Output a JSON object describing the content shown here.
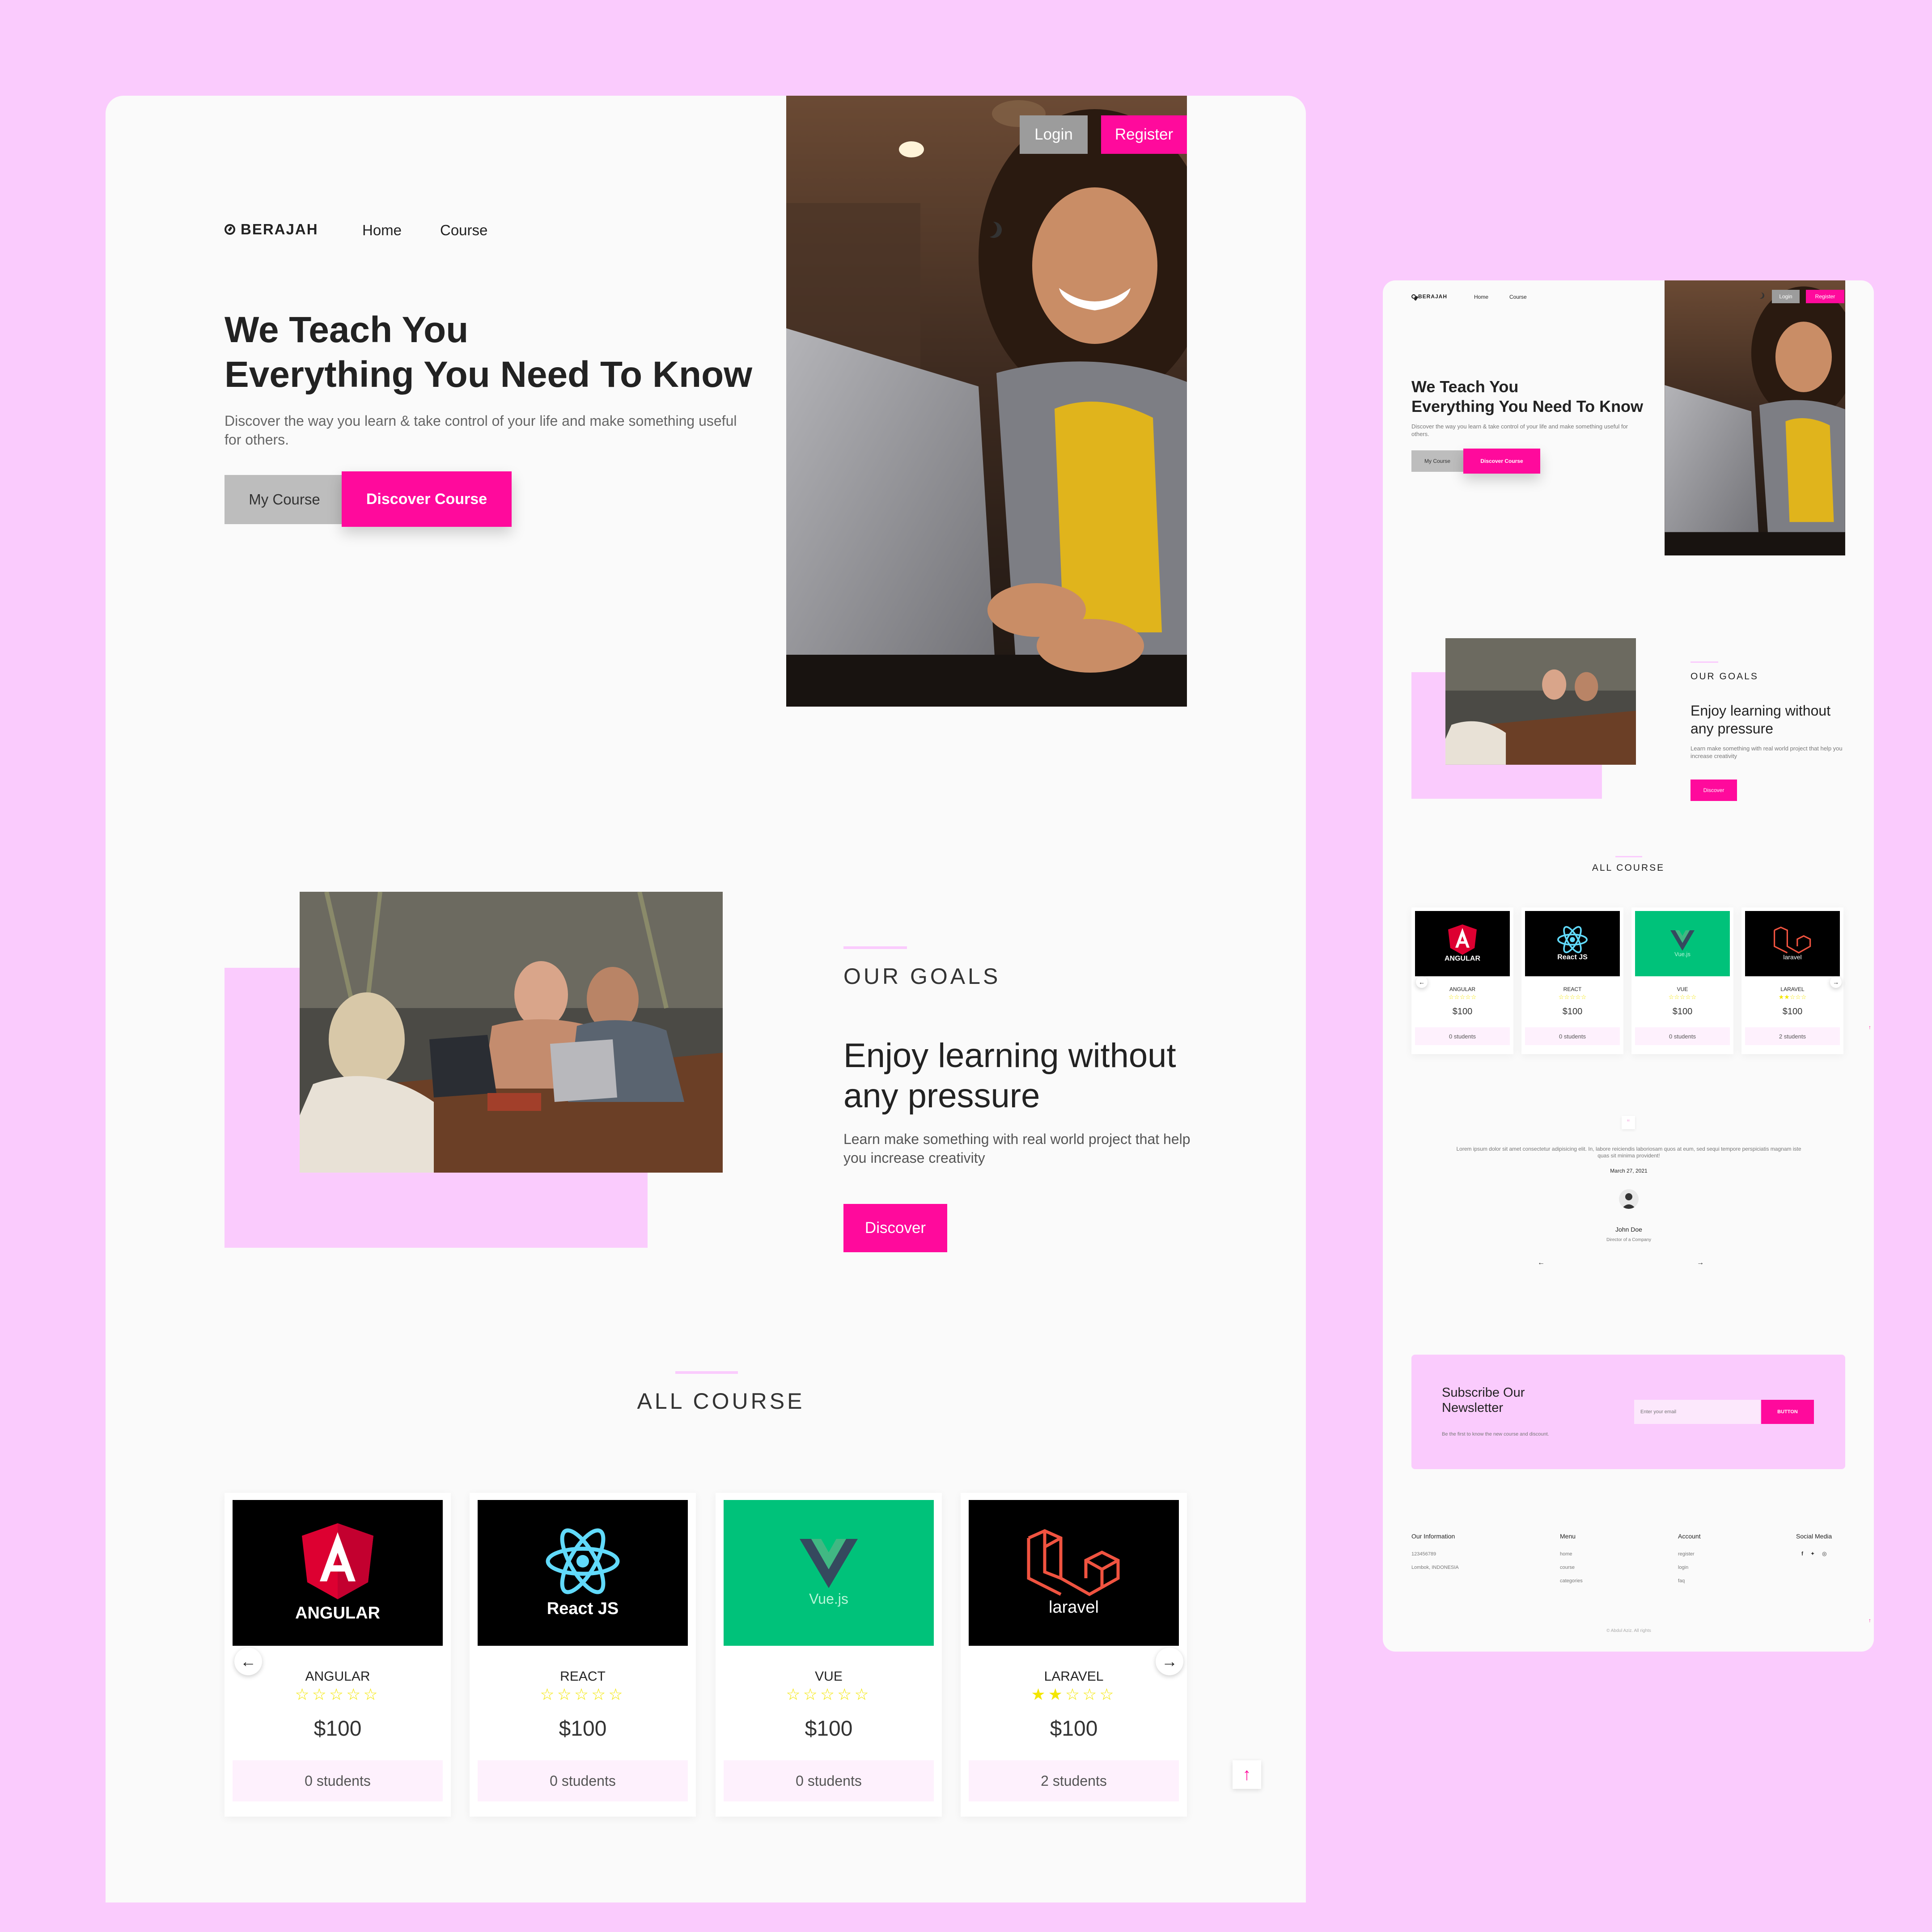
{
  "brand": "BERAJAH",
  "nav": {
    "home": "Home",
    "course": "Course"
  },
  "auth": {
    "login": "Login",
    "register": "Register"
  },
  "hero": {
    "title_line1": "We Teach You",
    "title_line2": "Everything You Need To Know",
    "description": "Discover the way you learn & take control of your life and make something useful for others.",
    "btn_my_course": "My Course",
    "btn_discover_course": "Discover Course"
  },
  "goals": {
    "label": "OUR GOALS",
    "title": "Enjoy learning without any pressure",
    "description": "Learn make something with real world project that help you increase creativity",
    "button": "Discover"
  },
  "all_course": {
    "title": "ALL COURSE",
    "courses": [
      {
        "name": "ANGULAR",
        "logo_text": "ANGULAR",
        "rating": 0,
        "price": "$100",
        "students": "0 students",
        "thumb_color": "#000000"
      },
      {
        "name": "REACT",
        "logo_text": "React JS",
        "rating": 0,
        "price": "$100",
        "students": "0 students",
        "thumb_color": "#000000"
      },
      {
        "name": "VUE",
        "logo_text": "Vue.js",
        "rating": 0,
        "price": "$100",
        "students": "0 students",
        "thumb_color": "#00c27a"
      },
      {
        "name": "LARAVEL",
        "logo_text": "laravel",
        "rating": 2,
        "price": "$100",
        "students": "2 students",
        "thumb_color": "#000000"
      }
    ]
  },
  "testimonial": {
    "quote": "Lorem ipsum dolor sit amet consectetur adipisicing elit. In, labore reiciendis laboriosam quos at eum, sed sequi tempore perspiciatis magnam iste quas sit minima provident!",
    "date": "March 27, 2021",
    "name": "John Doe",
    "role": "Director of a Company"
  },
  "newsletter": {
    "title_line1": "Subscribe Our",
    "title_line2": "Newsletter",
    "description": "Be the first to know the new course and discount.",
    "placeholder": "Enter your email",
    "button": "BUTTON"
  },
  "footer": {
    "info_title": "Our Information",
    "info_phone": "123456789",
    "info_address": "Lombok, INDONESIA",
    "menu_title": "Menu",
    "menu_items": [
      "home",
      "course",
      "categories"
    ],
    "account_title": "Account",
    "account_items": [
      "register",
      "login",
      "faq"
    ],
    "social_title": "Social Media",
    "copyright": "© Abdul Aziz. All rights"
  },
  "icons": [
    "compass-logo-icon",
    "moon-icon",
    "arrow-left-icon",
    "arrow-right-icon",
    "arrow-up-icon",
    "star-icon",
    "quote-icon",
    "facebook-icon",
    "twitter-icon",
    "instagram-icon"
  ],
  "colors": {
    "accent": "#ff0a9c",
    "background": "#facbfd",
    "gray_button": "#9c9c9c",
    "vue_green": "#00c27a",
    "star": "#f3e600"
  }
}
